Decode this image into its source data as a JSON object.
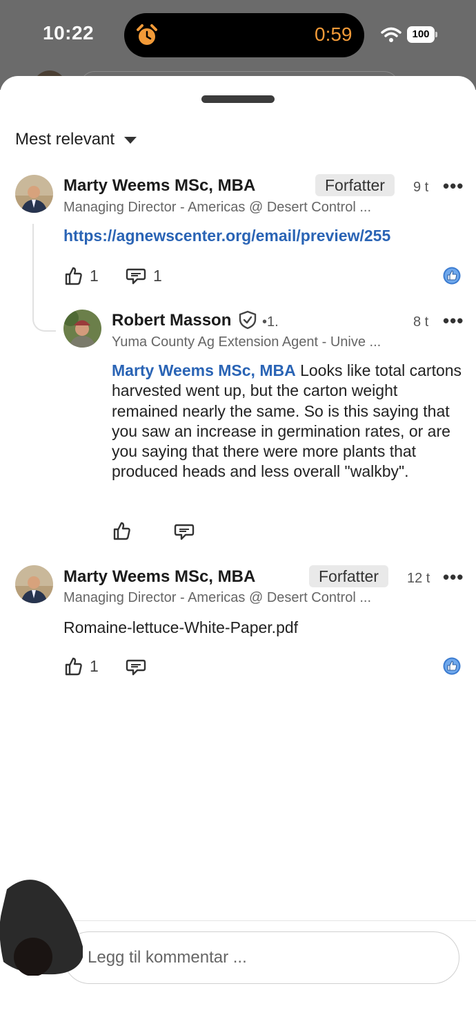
{
  "status_bar": {
    "time": "10:22",
    "timer": "0:59",
    "battery": "100"
  },
  "sheet": {
    "sort_label": "Mest relevant"
  },
  "comments": [
    {
      "author": "Marty Weems  MSc, MBA",
      "badge": "Forfatter",
      "age": "9 t",
      "headline": "Managing Director - Americas @ Desert Control ...",
      "link": "https://agnewscenter.org/email/preview/255",
      "likes": "1",
      "replies": "1"
    },
    {
      "author": "Marty Weems  MSc, MBA",
      "badge": "Forfatter",
      "age": "12 t",
      "headline": "Managing Director - Americas @ Desert Control ...",
      "attachment": "Romaine-lettuce-White-Paper.pdf",
      "likes": "1"
    }
  ],
  "reply": {
    "author": "Robert Masson",
    "degree": "•1.",
    "age": "8 t",
    "headline": "Yuma County Ag Extension Agent - Unive ...",
    "mention": "Marty Weems  MSc, MBA",
    "text": " Looks like total cartons harvested went up, but the carton weight remained nearly the same. So is this saying that you saw an increase in germination rates, or are you saying that there were more plants that produced heads and less overall \"walkby\"."
  },
  "composer": {
    "placeholder": "Legg til kommentar ..."
  },
  "colors": {
    "link": "#2a64b5",
    "timer": "#f29a38"
  }
}
